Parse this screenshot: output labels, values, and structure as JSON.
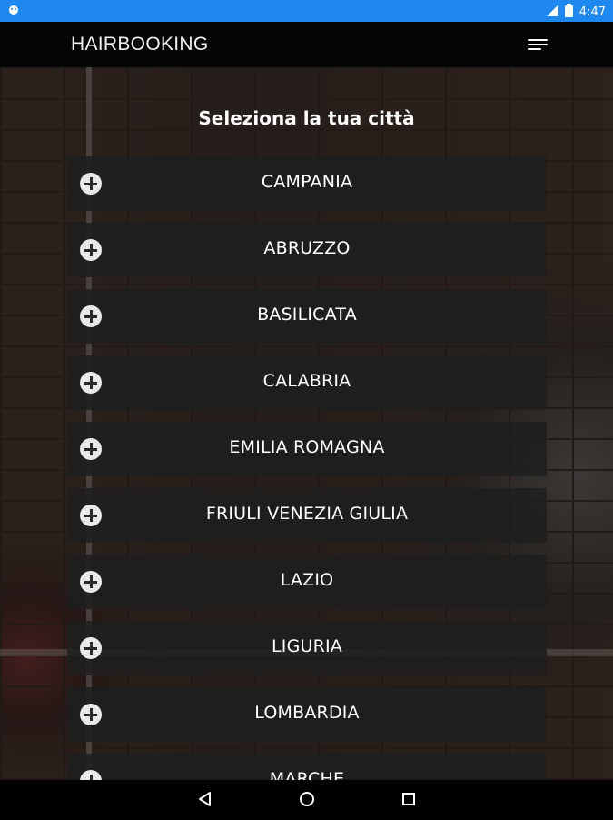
{
  "status_bar": {
    "time": "4:47",
    "icons": [
      "notification-icon",
      "signal-icon",
      "battery-icon"
    ]
  },
  "app_bar": {
    "logo": "HAIRBOOKING",
    "menu_icon": "hamburger-menu-icon"
  },
  "page": {
    "title": "Seleziona la tua città"
  },
  "regions": [
    "CAMPANIA",
    "ABRUZZO",
    "BASILICATA",
    "CALABRIA",
    "EMILIA ROMAGNA",
    "FRIULI VENEZIA GIULIA",
    "LAZIO",
    "LIGURIA",
    "LOMBARDIA",
    "MARCHE"
  ],
  "nav_bar": {
    "icons": [
      "back-icon",
      "home-icon",
      "recents-icon"
    ]
  },
  "colors": {
    "status_bar": "#1e88ef",
    "app_bar": "#050505",
    "item_bg": "#1e1e1e",
    "text": "#ffffff"
  }
}
